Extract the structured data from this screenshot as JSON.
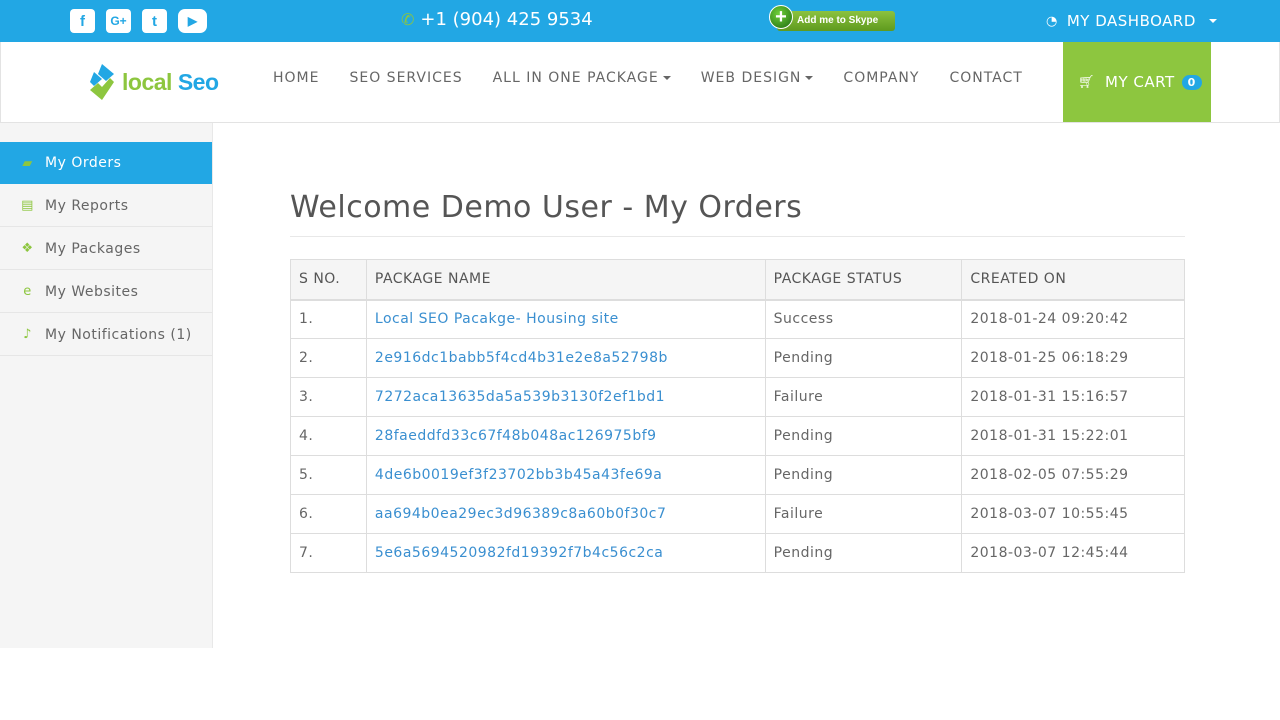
{
  "topbar": {
    "social": [
      {
        "icon": "facebook-icon",
        "glyph": "f"
      },
      {
        "icon": "google-plus-icon",
        "glyph": "G+"
      },
      {
        "icon": "twitter-icon",
        "glyph": "t"
      },
      {
        "icon": "youtube-icon",
        "glyph": "▶"
      }
    ],
    "phone": "+1 (904) 425 9534",
    "skype_label": "Add me to Skype",
    "dashboard_label": "MY DASHBOARD"
  },
  "nav": {
    "logo_local": "local",
    "logo_seo": "Seo",
    "menu": [
      "HOME",
      "SEO SERVICES",
      "ALL IN ONE PACKAGE",
      "WEB DESIGN",
      "COMPANY",
      "CONTACT"
    ],
    "cart_label": "MY CART",
    "cart_count": "0"
  },
  "sidebar": {
    "items": [
      {
        "label": "My Orders",
        "icon": "shopping-bag-icon"
      },
      {
        "label": "My Reports",
        "icon": "document-icon"
      },
      {
        "label": "My Packages",
        "icon": "cubes-icon"
      },
      {
        "label": "My Websites",
        "icon": "internet-explorer-icon"
      },
      {
        "label": "My Notifications (1)",
        "icon": "bell-icon"
      }
    ]
  },
  "main": {
    "title": "Welcome Demo User - My Orders",
    "columns": [
      "S NO.",
      "PACKAGE NAME",
      "PACKAGE STATUS",
      "CREATED ON"
    ],
    "rows": [
      [
        "1.",
        "Local SEO Pacakge- Housing site",
        "Success",
        "2018-01-24 09:20:42"
      ],
      [
        "2.",
        "2e916dc1babb5f4cd4b31e2e8a52798b",
        "Pending",
        "2018-01-25 06:18:29"
      ],
      [
        "3.",
        "7272aca13635da5a539b3130f2ef1bd1",
        "Failure",
        "2018-01-31 15:16:57"
      ],
      [
        "4.",
        "28faeddfd33c67f48b048ac126975bf9",
        "Pending",
        "2018-01-31 15:22:01"
      ],
      [
        "5.",
        "4de6b0019ef3f23702bb3b45a43fe69a",
        "Pending",
        "2018-02-05 07:55:29"
      ],
      [
        "6.",
        "aa694b0ea29ec3d96389c8a60b0f30c7",
        "Failure",
        "2018-03-07 10:55:45"
      ],
      [
        "7.",
        "5e6a5694520982fd19392f7b4c56c2ca",
        "Pending",
        "2018-03-07 12:45:44"
      ]
    ]
  },
  "colors": {
    "brand_blue": "#22a7e4",
    "brand_green": "#8dc63f",
    "link": "#3a8fd0"
  }
}
